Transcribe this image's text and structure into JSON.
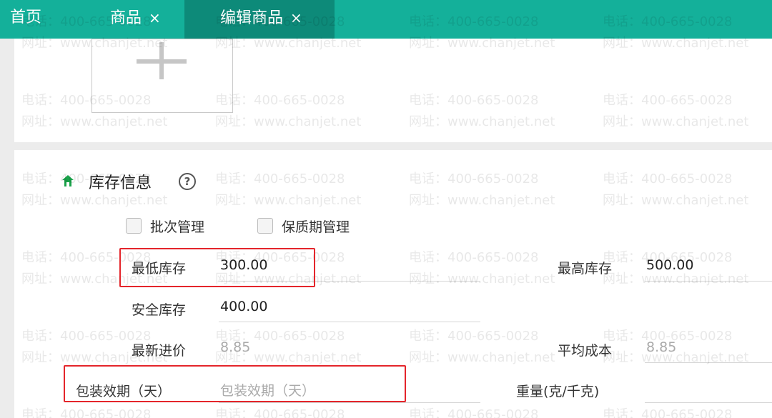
{
  "tabs": [
    {
      "label": "首页"
    },
    {
      "label": "商品",
      "close": "×"
    },
    {
      "label": "编辑商品",
      "close": "×"
    }
  ],
  "watermark": {
    "phone": "电话：400-665-0028",
    "url": "网址：www.chanjet.net"
  },
  "inventory": {
    "title": "库存信息",
    "help": "?",
    "batch_label": "批次管理",
    "shelf_life_label": "保质期管理",
    "fields": {
      "min_stock_label": "最低库存",
      "min_stock_value": "300.00",
      "max_stock_label": "最高库存",
      "max_stock_value": "500.00",
      "safe_stock_label": "安全库存",
      "safe_stock_value": "400.00",
      "latest_price_label": "最新进价",
      "latest_price_value": "8.85",
      "avg_cost_label": "平均成本",
      "avg_cost_value": "8.85",
      "pack_life_label": "包装效期（天）",
      "pack_life_placeholder": "包装效期（天）",
      "weight_label": "重量(克/千克)"
    }
  },
  "colors": {
    "tabbar": "#14b09a",
    "tab_active": "#0d8a79",
    "highlight": "#e4252b",
    "section_icon": "#1aa34a"
  }
}
